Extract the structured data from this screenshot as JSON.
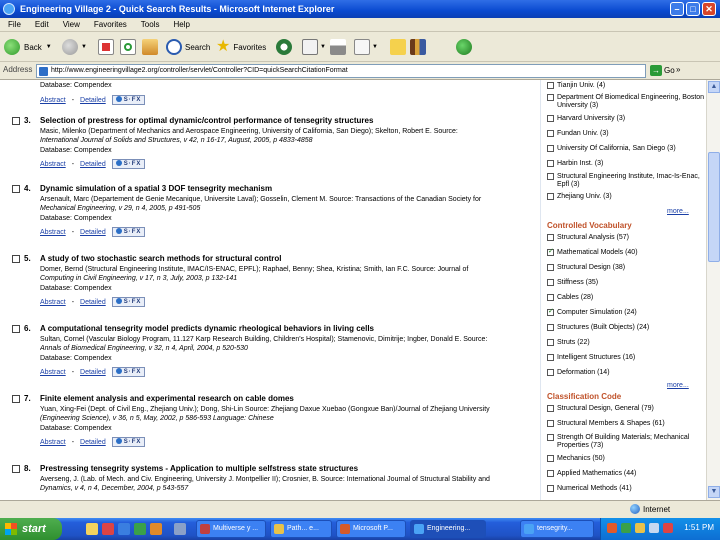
{
  "window": {
    "title": "Engineering Village 2 - Quick Search Results - Microsoft Internet Explorer",
    "minimize": "–",
    "maximize": "□",
    "close": "✕"
  },
  "menu": [
    "File",
    "Edit",
    "View",
    "Favorites",
    "Tools",
    "Help"
  ],
  "toolbar": {
    "back": "Back",
    "search": "Search",
    "favorites": "Favorites"
  },
  "address": {
    "label": "Address",
    "url": "http://www.engineeringvillage2.org/controller/servlet/Controller?CID=quickSearchCitationFormat",
    "go": "Go",
    "links": "»"
  },
  "results": [
    {
      "num": "",
      "title": "",
      "authors": "",
      "db": "Database: Compendex",
      "abstract": "Abstract",
      "detailed": "Detailed",
      "sfx": "S·FX"
    },
    {
      "num": "3.",
      "title": "Selection of prestress for optimal dynamic/control performance of tensegrity structures",
      "authors": "Masic, Milenko (Department of Mechanics and Aerospace Engineering, University of California, San Diego); Skelton, Robert E. Source:",
      "authors2": "International Journal of Solids and Structures, v 42, n 16-17, August, 2005, p 4833-4858",
      "db": "Database: Compendex",
      "abstract": "Abstract",
      "detailed": "Detailed",
      "sfx": "S·FX"
    },
    {
      "num": "4.",
      "title": "Dynamic simulation of a spatial 3 DOF tensegrity mechanism",
      "authors": "Arsenault, Marc (Departement de Genie Mecanique, Universite Laval); Gosselin, Clement M. Source: Transactions of the Canadian Society for",
      "authors2": "Mechanical Engineering, v 29, n 4, 2005, p 491-505",
      "db": "Database: Compendex",
      "abstract": "Abstract",
      "detailed": "Detailed",
      "sfx": "S·FX"
    },
    {
      "num": "5.",
      "title": "A study of two stochastic search methods for structural control",
      "authors": "Domer, Bernd (Structural Engineering Institute, IMAC/IS-ENAC, EPFL); Raphael, Benny; Shea, Kristina; Smith, Ian F.C. Source: Journal of",
      "authors2": "Computing in Civil Engineering, v 17, n 3, July, 2003, p 132-141",
      "db": "Database: Compendex",
      "abstract": "Abstract",
      "detailed": "Detailed",
      "sfx": "S·FX"
    },
    {
      "num": "6.",
      "title": "A computational tensegrity model predicts dynamic rheological behaviors in living cells",
      "authors": "Sultan, Cornel (Vascular Biology Program, 11.127 Karp Research Building, Children's Hospital); Stamenovic, Dimitrije; Ingber, Donald E. Source:",
      "authors2": "Annals of Biomedical Engineering, v 32, n 4, April, 2004, p 520-530",
      "db": "Database: Compendex",
      "abstract": "Abstract",
      "detailed": "Detailed",
      "sfx": "S·FX"
    },
    {
      "num": "7.",
      "title": "Finite element analysis and experimental research on cable domes",
      "authors": "Yuan, Xing-Fei (Dept. of Civil Eng., Zhejiang Univ.); Dong, Shi-Lin Source: Zhejiang Daxue Xuebao (Gongxue Ban)/Journal of Zhejiang University",
      "authors2": "(Engineering Science), v 36, n 5, May, 2002, p 586-593 Language: Chinese",
      "db": "Database: Compendex",
      "abstract": "Abstract",
      "detailed": "Detailed",
      "sfx": "S·FX"
    },
    {
      "num": "8.",
      "title": "Prestressing tensegrity systems - Application to multiple selfstress state structures",
      "authors": "Averseng, J. (Lab. of Mech. and Civ. Engineering, University J. Montpellier II); Crosnier, B. Source: International Journal of Structural Stability and",
      "authors2": "Dynamics, v 4, n 4, December, 2004, p 543-557",
      "db": "",
      "abstract": "",
      "detailed": "",
      "sfx": ""
    }
  ],
  "sidebar": {
    "top_items": [
      {
        "label": "Tianjin Univ. (4)",
        "checked": false
      },
      {
        "label": "Department Of Biomedical Engineering, Boston University (3)",
        "checked": false
      },
      {
        "label": "Harvard University (3)",
        "checked": false
      },
      {
        "label": "Fundan Univ. (3)",
        "checked": false
      },
      {
        "label": "University Of California, San Diego (3)",
        "checked": false
      },
      {
        "label": "Harbin Inst. (3)",
        "checked": false
      },
      {
        "label": "Structural Engineering Institute, Imac-Is-Enac, Epfl (3)",
        "checked": false
      },
      {
        "label": "Zhejiang Univ. (3)",
        "checked": false
      }
    ],
    "more1": "more...",
    "cv_title": "Controlled Vocabulary",
    "cv_items": [
      {
        "label": "Structural Analysis (57)",
        "checked": false
      },
      {
        "label": "Mathematical Models (40)",
        "checked": true
      },
      {
        "label": "Structural Design (38)",
        "checked": false
      },
      {
        "label": "Stiffness (35)",
        "checked": false
      },
      {
        "label": "Cables (28)",
        "checked": false
      },
      {
        "label": "Computer Simulation (24)",
        "checked": true
      },
      {
        "label": "Structures (Built Objects) (24)",
        "checked": false
      },
      {
        "label": "Struts (22)",
        "checked": false
      },
      {
        "label": "Intelligent Structures (16)",
        "checked": false
      },
      {
        "label": "Deformation (14)",
        "checked": false
      }
    ],
    "more2": "more...",
    "cc_title": "Classification Code",
    "cc_items": [
      {
        "label": "Structural Design, General (79)",
        "checked": false
      },
      {
        "label": "Structural Members & Shapes (61)",
        "checked": false
      },
      {
        "label": "Strength Of Building Materials; Mechanical Properties (73)",
        "checked": false
      },
      {
        "label": "Mechanics (50)",
        "checked": false
      },
      {
        "label": "Applied Mathematics (44)",
        "checked": false
      },
      {
        "label": "Numerical Methods (41)",
        "checked": false
      }
    ]
  },
  "status": {
    "zone": "Internet"
  },
  "taskbar": {
    "start": "start",
    "tasks": [
      "Multiverse y ...",
      "Path... e...",
      "Microsoft P...",
      "Engineering...",
      "tensegrity..."
    ],
    "clock": "1:51 PM"
  },
  "colors": {
    "title_blue": "#0a4ad0",
    "link_blue": "#1a3fa6",
    "facet_orange": "#c0522a",
    "start_green": "#2f8f2f"
  }
}
